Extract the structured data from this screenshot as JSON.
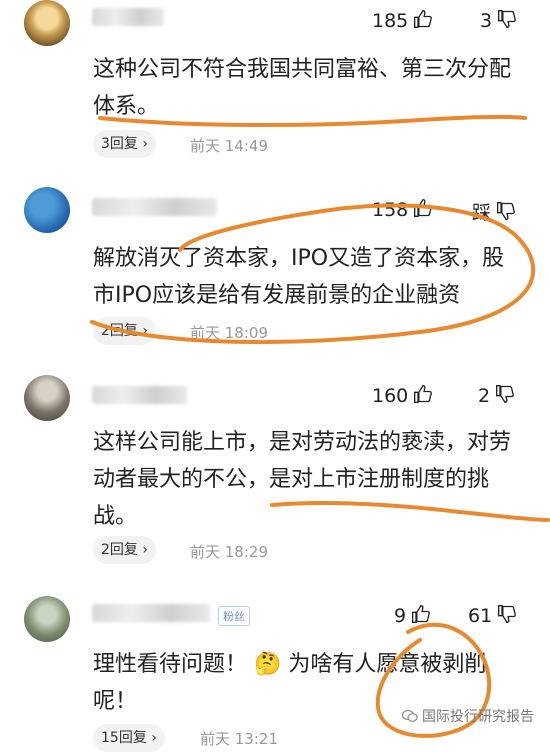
{
  "comments": [
    {
      "likes": "185",
      "dislike_value": "3",
      "text_lines": [
        "这种公司不符合我国共同富裕、第三次分配",
        "体系。"
      ],
      "reply_label": "3回复 ›",
      "time": "前天  14:49"
    },
    {
      "likes": "158",
      "dislike_value": "踩",
      "text_lines": [
        "解放消灭了资本家，IPO又造了资本家，股",
        "市IPO应该是给有发展前景的企业融资"
      ],
      "reply_label": "2回复 ›",
      "time": "前天  18:09"
    },
    {
      "likes": "160",
      "dislike_value": "2",
      "text_lines": [
        "这样公司能上市，是对劳动法的亵渎，对劳",
        "动者最大的不公，是对上市注册制度的挑",
        "战。"
      ],
      "reply_label": "2回复 ›",
      "time": "前天  18:29"
    },
    {
      "likes": "9",
      "dislike_value": "61",
      "badge": "粉丝",
      "text_lines": [
        "理性看待问题！ 🤔 为啥有人愿意被剥削",
        "呢！"
      ],
      "reply_label": "15回复 ›",
      "time": "前天  13:21"
    }
  ],
  "watermark": "国际投行研究报告",
  "colors": {
    "annotation": "#e8892f",
    "text": "#222222",
    "meta": "#999999"
  },
  "icons": [
    "thumbs-up-icon",
    "thumbs-down-icon"
  ]
}
